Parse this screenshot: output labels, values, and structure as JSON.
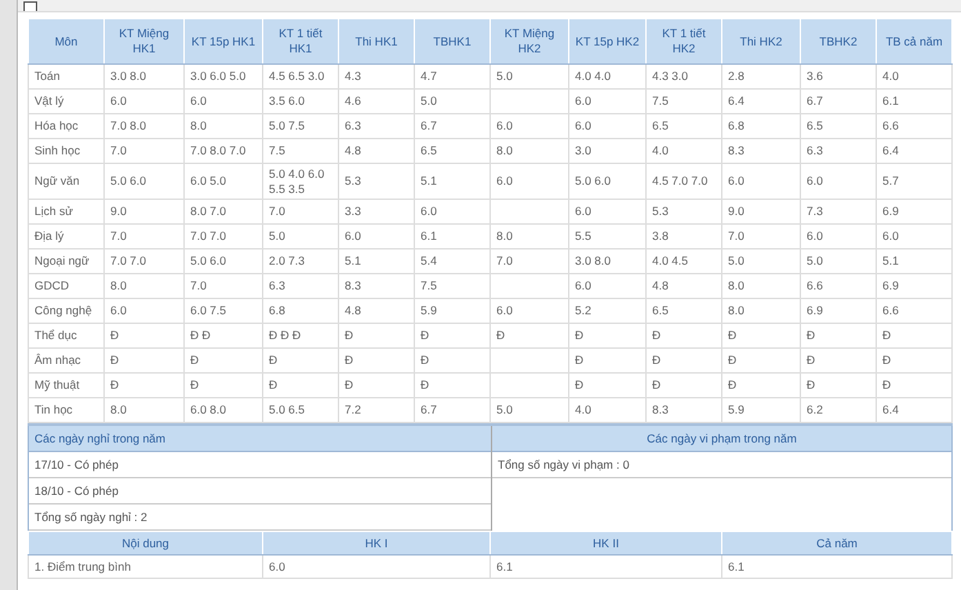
{
  "grades": {
    "columns": [
      "Môn",
      "KT Miệng HK1",
      "KT 15p HK1",
      "KT 1 tiết HK1",
      "Thi HK1",
      "TBHK1",
      "KT Miệng HK2",
      "KT 15p HK2",
      "KT 1 tiết HK2",
      "Thi HK2",
      "TBHK2",
      "TB cả năm"
    ],
    "rows": [
      [
        "Toán",
        "3.0 8.0",
        "3.0 6.0 5.0",
        "4.5 6.5 3.0",
        "4.3",
        "4.7",
        "5.0",
        "4.0 4.0",
        "4.3 3.0",
        "2.8",
        "3.6",
        "4.0"
      ],
      [
        "Vật lý",
        "6.0",
        "6.0",
        "3.5 6.0",
        "4.6",
        "5.0",
        null,
        "6.0",
        "7.5",
        "6.4",
        "6.7",
        "6.1"
      ],
      [
        "Hóa học",
        "7.0 8.0",
        "8.0",
        "5.0 7.5",
        "6.3",
        "6.7",
        "6.0",
        "6.0",
        "6.5",
        "6.8",
        "6.5",
        "6.6"
      ],
      [
        "Sinh học",
        "7.0",
        "7.0 8.0 7.0",
        "7.5",
        "4.8",
        "6.5",
        "8.0",
        "3.0",
        "4.0",
        "8.3",
        "6.3",
        "6.4"
      ],
      [
        "Ngữ văn",
        "5.0 6.0",
        "6.0 5.0",
        "5.0 4.0 6.0 5.5 3.5",
        "5.3",
        "5.1",
        "6.0",
        "5.0 6.0",
        "4.5 7.0 7.0",
        "6.0",
        "6.0",
        "5.7"
      ],
      [
        "Lịch sử",
        "9.0",
        "8.0 7.0",
        "7.0",
        "3.3",
        "6.0",
        null,
        "6.0",
        "5.3",
        "9.0",
        "7.3",
        "6.9"
      ],
      [
        "Địa lý",
        "7.0",
        "7.0 7.0",
        "5.0",
        "6.0",
        "6.1",
        "8.0",
        "5.5",
        "3.8",
        "7.0",
        "6.0",
        "6.0"
      ],
      [
        "Ngoại ngữ",
        "7.0 7.0",
        "5.0 6.0",
        "2.0 7.3",
        "5.1",
        "5.4",
        "7.0",
        "3.0 8.0",
        "4.0 4.5",
        "5.0",
        "5.0",
        "5.1"
      ],
      [
        "GDCD",
        "8.0",
        "7.0",
        "6.3",
        "8.3",
        "7.5",
        null,
        "6.0",
        "4.8",
        "8.0",
        "6.6",
        "6.9"
      ],
      [
        "Công nghệ",
        "6.0",
        "6.0 7.5",
        "6.8",
        "4.8",
        "5.9",
        "6.0",
        "5.2",
        "6.5",
        "8.0",
        "6.9",
        "6.6"
      ],
      [
        "Thể dục",
        "Đ",
        "Đ Đ",
        "Đ Đ Đ",
        "Đ",
        "Đ",
        "Đ",
        "Đ",
        "Đ",
        "Đ",
        "Đ",
        "Đ"
      ],
      [
        "Âm nhạc",
        "Đ",
        "Đ",
        "Đ",
        "Đ",
        "Đ",
        null,
        "Đ",
        "Đ",
        "Đ",
        "Đ",
        "Đ"
      ],
      [
        "Mỹ thuật",
        "Đ",
        "Đ",
        "Đ",
        "Đ",
        "Đ",
        null,
        "Đ",
        "Đ",
        "Đ",
        "Đ",
        "Đ"
      ],
      [
        "Tin học",
        "8.0",
        "6.0 8.0",
        "5.0 6.5",
        "7.2",
        "6.7",
        "5.0",
        "4.0",
        "8.3",
        "5.9",
        "6.2",
        "6.4"
      ]
    ]
  },
  "absences": {
    "title": "Các ngày nghỉ trong năm",
    "items": [
      "17/10 - Có phép",
      "18/10 - Có phép",
      "Tổng số ngày nghỉ : 2"
    ]
  },
  "violations": {
    "title": "Các ngày vi phạm trong năm",
    "items": [
      "Tổng số ngày vi phạm : 0"
    ]
  },
  "summary": {
    "columns": [
      "Nội dung",
      "HK I",
      "HK II",
      "Cả năm"
    ],
    "rows": [
      [
        "1. Điểm trung bình",
        "6.0",
        "6.1",
        "6.1"
      ]
    ]
  }
}
